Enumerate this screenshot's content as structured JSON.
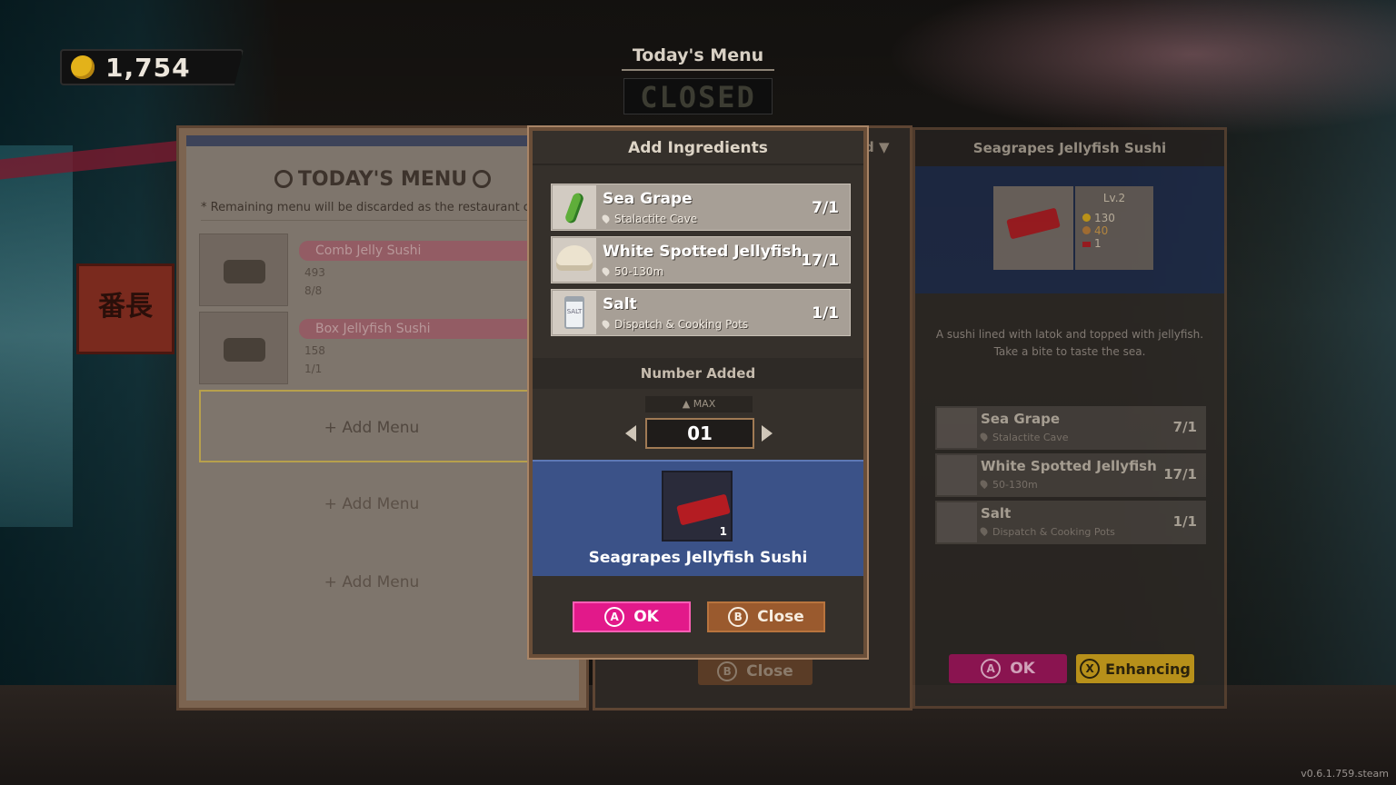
{
  "hud": {
    "coins": "1,754",
    "todays_menu_label": "Today's Menu",
    "status_sign": "CLOSED"
  },
  "menu_panel": {
    "title": "TODAY'S MENU",
    "note": "* Remaining menu will be discarded as the restaurant cl",
    "items": [
      {
        "name": "Comb Jelly Sushi",
        "price": "493",
        "stock": "8/8"
      },
      {
        "name": "Box Jellyfish Sushi",
        "price": "158",
        "stock": "1/1"
      }
    ],
    "add_slots": [
      "+ Add Menu",
      "+ Add Menu",
      "+ Add Menu"
    ]
  },
  "modal": {
    "title": "Add Ingredients",
    "ingredients": [
      {
        "name": "Sea Grape",
        "location": "Stalactite Cave",
        "count": "7/1",
        "icon": "sea-grape-icon"
      },
      {
        "name": "White Spotted Jellyfish",
        "location": "50-130m",
        "count": "17/1",
        "icon": "jellyfish-icon"
      },
      {
        "name": "Salt",
        "location": "Dispatch & Cooking Pots",
        "count": "1/1",
        "icon": "salt-icon"
      }
    ],
    "salt_label": "SALT",
    "section_label": "Number Added",
    "max_label": "▲ MAX",
    "quantity": "01",
    "result_name": "Seagrapes Jellyfish Sushi",
    "result_count": "1",
    "ok_key": "A",
    "ok_label": "OK",
    "close_key": "B",
    "close_label": "Close"
  },
  "middle_panel": {
    "header_fragment": "d ▼",
    "close_key": "B",
    "close_label": "Close"
  },
  "recipe_panel": {
    "title": "Seagrapes Jellyfish Sushi",
    "level": "Lv.2",
    "price": "130",
    "taste": "40",
    "servings": "1",
    "description": "A sushi lined with latok and topped with jellyfish. Take a bite to taste the sea.",
    "ingredients": [
      {
        "name": "Sea Grape",
        "location": "Stalactite Cave",
        "count": "7/1"
      },
      {
        "name": "White Spotted Jellyfish",
        "location": "50-130m",
        "count": "17/1"
      },
      {
        "name": "Salt",
        "location": "Dispatch & Cooking Pots",
        "count": "1/1"
      }
    ],
    "ok_key": "A",
    "ok_label": "OK",
    "enhance_key": "X",
    "enhance_label": "Enhancing"
  },
  "version": "v0.6.1.759.steam",
  "colors": {
    "ok_pink": "#e2198a",
    "close_brown": "#9a5a2e",
    "result_blue": "#3b5288",
    "coin_gold": "#e3b21a"
  }
}
